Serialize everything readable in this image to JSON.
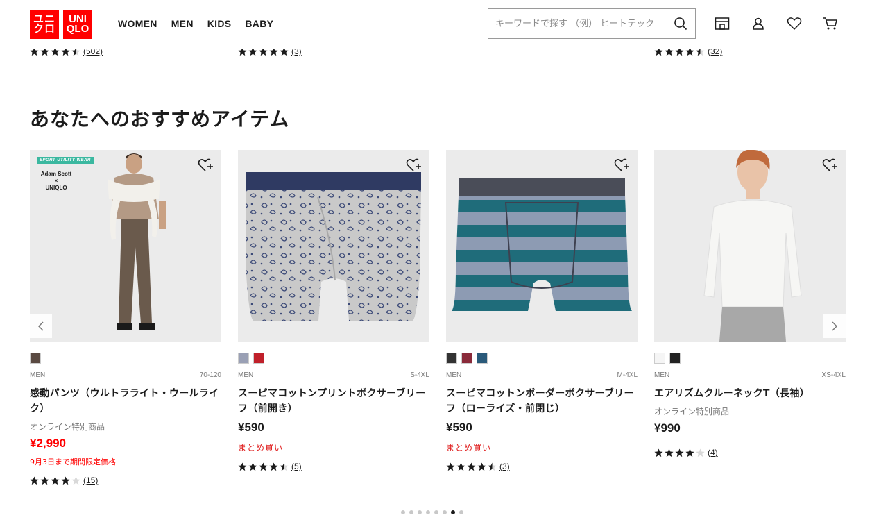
{
  "header": {
    "logo_jp": [
      "ユニ",
      "クロ"
    ],
    "logo_en": [
      "UNI",
      "QLO"
    ],
    "nav": [
      "WOMEN",
      "MEN",
      "KIDS",
      "BABY"
    ],
    "search_placeholder": "キーワードで探す （例） ヒートテック",
    "icons": [
      "store-icon",
      "user-icon",
      "heart-icon",
      "cart-icon"
    ],
    "brand_color": "#ff0000"
  },
  "top_ratings": [
    {
      "stars": 4.5,
      "count": "(502)"
    },
    {
      "stars": 5,
      "count": "(3)"
    },
    {
      "stars": 4.5,
      "count": "(32)"
    }
  ],
  "section_title": "あなたへのおすすめアイテム",
  "products": [
    {
      "badge": "SPORT UTILITY WEAR",
      "collab": "Adam Scott",
      "collab_x": "×",
      "collab_brand": "UNIQLO",
      "swatches": [
        "#5a4a42"
      ],
      "gender": "MEN",
      "size": "70-120",
      "name": "感動パンツ（ウルトラライト・ウールライク）",
      "note": "オンライン特別商品",
      "price": "¥2,990",
      "promo": "9月3日まで期間限定価格",
      "stars": 4,
      "count": "(15)"
    },
    {
      "swatches": [
        "#9aa0b5",
        "#c0202a"
      ],
      "gender": "MEN",
      "size": "S-4XL",
      "name": "スーピマコットンプリントボクサーブリーフ（前開き）",
      "price": "¥590",
      "promo": "まとめ買い",
      "stars": 4.5,
      "count": "(5)"
    },
    {
      "swatches": [
        "#333",
        "#8a2a3a",
        "#2a5a7a"
      ],
      "gender": "MEN",
      "size": "M-4XL",
      "name": "スーピマコットンボーダーボクサーブリーフ（ローライズ・前閉じ）",
      "price": "¥590",
      "promo": "まとめ買い",
      "stars": 4.5,
      "count": "(3)"
    },
    {
      "swatches": [
        "#f5f5f5",
        "#222"
      ],
      "gender": "MEN",
      "size": "XS-4XL",
      "name": "エアリズムクルーネックT（長袖）",
      "note": "オンライン特別商品",
      "price": "¥990",
      "stars": 4,
      "count": "(4)"
    }
  ],
  "carousel": {
    "total": 8,
    "active_index": 6
  }
}
